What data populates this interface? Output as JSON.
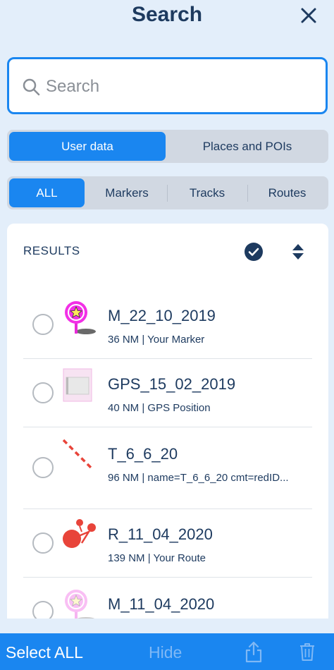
{
  "header": {
    "title": "Search",
    "close_icon": "close-icon"
  },
  "search": {
    "placeholder": "Search",
    "value": "",
    "icon": "search-icon"
  },
  "source_tabs": [
    {
      "label": "User data",
      "active": true
    },
    {
      "label": "Places and POIs",
      "active": false
    }
  ],
  "type_tabs": [
    {
      "label": "ALL",
      "active": true
    },
    {
      "label": "Markers",
      "active": false
    },
    {
      "label": "Tracks",
      "active": false
    },
    {
      "label": "Routes",
      "active": false
    }
  ],
  "results": {
    "heading": "RESULTS",
    "items": [
      {
        "name": "M_22_10_2019",
        "subtitle": "36 NM | Your Marker",
        "icon": "star-marker-icon"
      },
      {
        "name": "GPS_15_02_2019",
        "subtitle": "40 NM | GPS Position",
        "icon": "gps-position-icon"
      },
      {
        "name": "T_6_6_20",
        "subtitle": "96 NM | name=T_6_6_20 cmt=redID...",
        "icon": "track-icon"
      },
      {
        "name": "R_11_04_2020",
        "subtitle": "139 NM | Your Route",
        "icon": "route-icon"
      },
      {
        "name": "M_11_04_2020",
        "subtitle": "",
        "icon": "star-marker-icon"
      }
    ]
  },
  "bottom_bar": {
    "select_all": "Select ALL",
    "hide": "Hide"
  },
  "colors": {
    "accent": "#1a86f0",
    "text": "#1d3a5f",
    "background": "#e3eefa"
  }
}
